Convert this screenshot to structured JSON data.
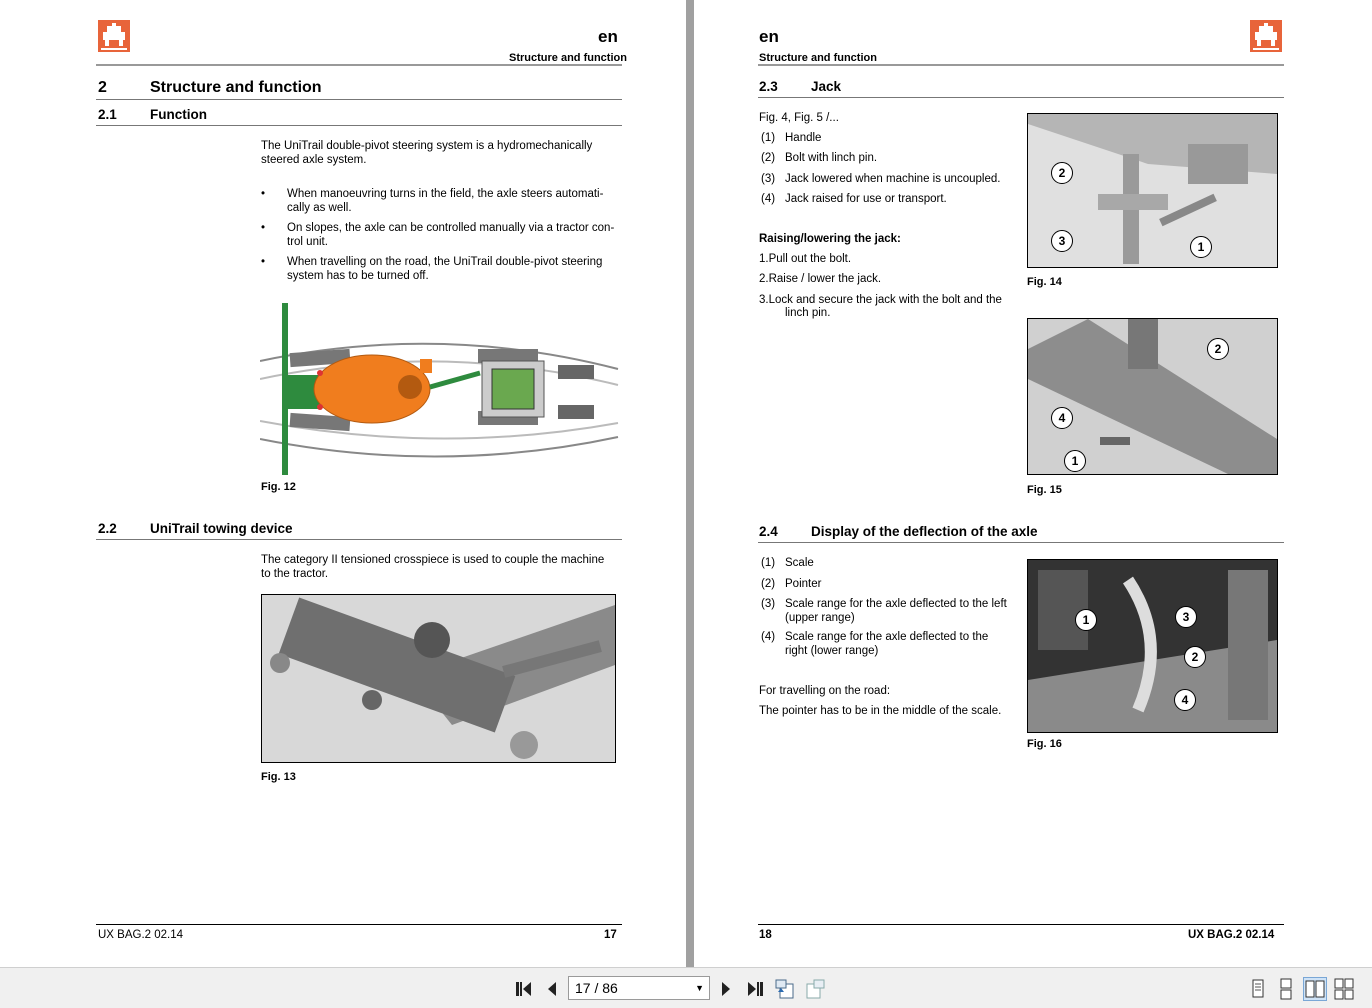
{
  "left_page": {
    "lang": "en",
    "running_head": "Structure and function",
    "section": {
      "num": "2",
      "title": "Structure and function"
    },
    "sub1": {
      "num": "2.1",
      "title": "Function"
    },
    "intro": [
      "The UniTrail double-pivot steering system is a hydromechanically",
      "steered axle system."
    ],
    "bullets": [
      [
        "When manoeuvring turns in the field, the axle steers automati-",
        "cally as well."
      ],
      [
        "On slopes, the axle can be controlled manually via a tractor con-",
        "trol unit."
      ],
      [
        "When travelling on the road, the UniTrail double-pivot steering",
        "system has to be turned off."
      ]
    ],
    "fig12_caption": "Fig. 12",
    "sub2": {
      "num": "2.2",
      "title": "UniTrail towing device"
    },
    "towing_text": [
      "The category II tensioned crosspiece is used to couple the machine",
      "to the tractor."
    ],
    "fig13_caption": "Fig. 13",
    "footer_left": "UX  BAG.2   02.14",
    "footer_page": "17"
  },
  "right_page": {
    "lang": "en",
    "running_head": "Structure and function",
    "sub3": {
      "num": "2.3",
      "title": "Jack"
    },
    "fig_ref": "Fig. 4, Fig. 5 /...",
    "jack_items": [
      {
        "n": "(1)",
        "t": "Handle"
      },
      {
        "n": "(2)",
        "t": "Bolt with linch pin."
      },
      {
        "n": "(3)",
        "t": "Jack lowered when machine is uncoupled."
      },
      {
        "n": "(4)",
        "t": "Jack raised for use or transport."
      }
    ],
    "raising_heading": "Raising/lowering the jack:",
    "steps": [
      "1.Pull out the bolt.",
      "2.Raise / lower the jack.",
      "3.Lock and secure the jack with the bolt and the",
      "linch pin."
    ],
    "fig14_caption": "Fig. 14",
    "fig15_caption": "Fig. 15",
    "sub4": {
      "num": "2.4",
      "title": "Display of the deflection of the axle"
    },
    "axle_items": [
      {
        "n": "(1)",
        "t": "Scale",
        "t2": ""
      },
      {
        "n": "(2)",
        "t": "Pointer",
        "t2": ""
      },
      {
        "n": "(3)",
        "t": "Scale range for the axle deflected to the left",
        "t2": "(upper range)"
      },
      {
        "n": "(4)",
        "t": "Scale range for the axle deflected to the",
        "t2": "right (lower range)"
      }
    ],
    "road_text": "For travelling on the road:",
    "pointer_text": "The pointer has to be in the middle of the scale.",
    "fig16_caption": "Fig. 16",
    "footer_page": "18",
    "footer_right": "UX BAG.2   02.14",
    "callouts": {
      "c1": "1",
      "c2": "2",
      "c3": "3",
      "c4": "4"
    }
  },
  "toolbar": {
    "page_value": "17 / 86",
    "icons": [
      "first-page-icon",
      "previous-page-icon",
      "next-page-icon",
      "last-page-icon",
      "go-back-icon",
      "go-forward-icon",
      "single-page-view-icon",
      "continuous-view-icon",
      "two-page-view-icon",
      "two-page-continuous-view-icon"
    ]
  },
  "colors": {
    "brand": "#e8643a",
    "page_bg": "#ffffff",
    "gutter": "#a0a0a0",
    "toolbar": "#f0f0f0",
    "tractor_green": "#2e8b3e",
    "implement_orange": "#f07d1e"
  }
}
